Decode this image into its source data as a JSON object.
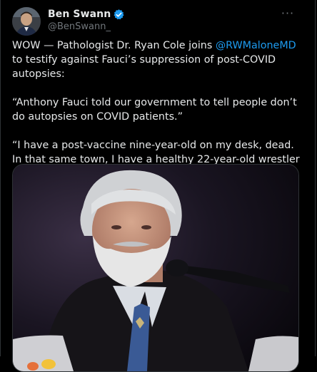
{
  "author": {
    "display_name": "Ben Swann",
    "handle": "@BenSwann_",
    "verified_icon": "verified-badge-icon",
    "avatar_icon": "profile-avatar"
  },
  "menu": {
    "more_label": "···"
  },
  "tweet": {
    "line1_before": "WOW — Pathologist Dr. Ryan Cole joins ",
    "mention": "@RWMaloneMD",
    "line1_after": " to testify against Fauci’s suppression of post-COVID autopsies:",
    "quote1": "“Anthony Fauci told our government to tell people don’t do autopsies on COVID patients.”",
    "quote2": "“I have a post-vaccine nine-year-old on my desk, dead. In that same town, I have a healthy 22-year-old wrestler coming to my desk so I can determine the cause of death.”"
  },
  "media": {
    "type": "video-still",
    "subject": "gray-bearded man speaking at microphone"
  },
  "colors": {
    "background": "#000000",
    "text": "#e7e9ea",
    "secondary": "#71767b",
    "accent": "#1d9bf0",
    "border": "#2f3336"
  }
}
